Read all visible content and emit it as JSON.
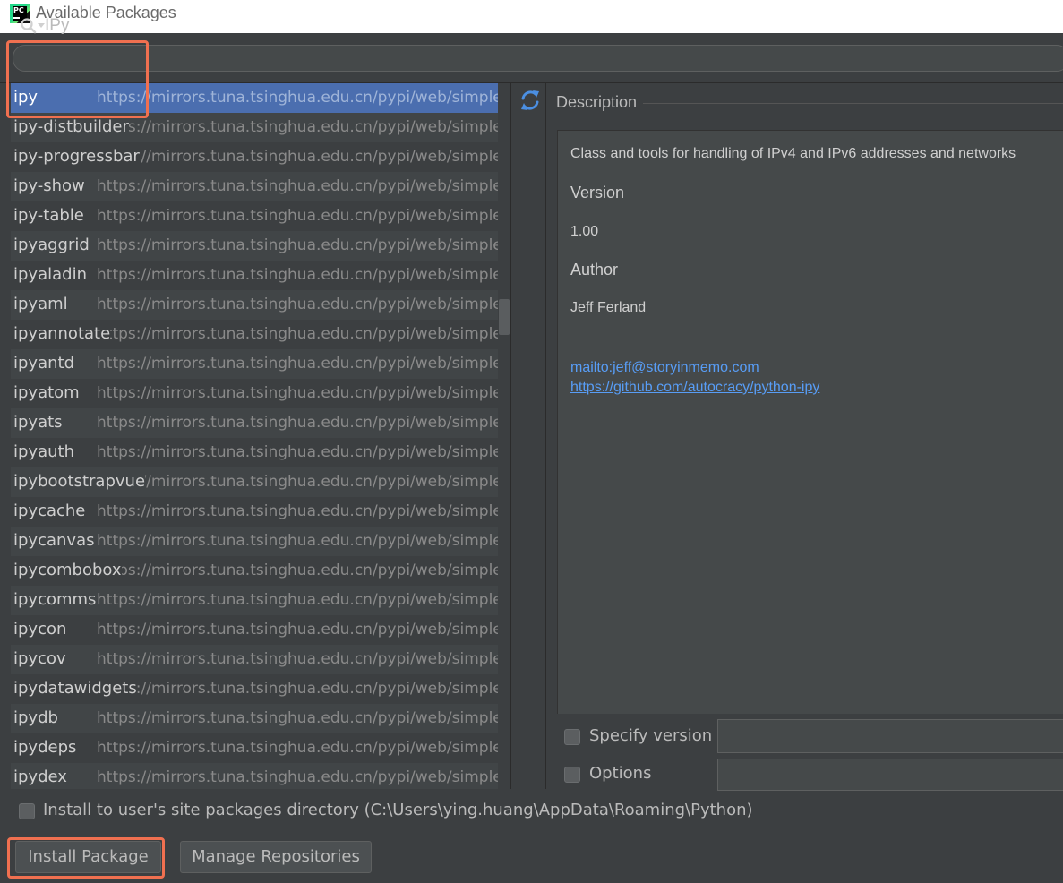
{
  "window": {
    "title": "Available Packages",
    "app_icon": "pycharm-icon",
    "app_icon_text": "PC"
  },
  "search": {
    "value": "IPy",
    "icon": "search-icon"
  },
  "packages": [
    {
      "name": "ipy",
      "repo": "https://mirrors.tuna.tsinghua.edu.cn/pypi/web/simple/"
    },
    {
      "name": "ipy-distbuilder",
      "repo": "https://mirrors.tuna.tsinghua.edu.cn/pypi/web/simple/"
    },
    {
      "name": "ipy-progressbar",
      "repo": "https://mirrors.tuna.tsinghua.edu.cn/pypi/web/simple/"
    },
    {
      "name": "ipy-show",
      "repo": "https://mirrors.tuna.tsinghua.edu.cn/pypi/web/simple/"
    },
    {
      "name": "ipy-table",
      "repo": "https://mirrors.tuna.tsinghua.edu.cn/pypi/web/simple/"
    },
    {
      "name": "ipyaggrid",
      "repo": "https://mirrors.tuna.tsinghua.edu.cn/pypi/web/simple/"
    },
    {
      "name": "ipyaladin",
      "repo": "https://mirrors.tuna.tsinghua.edu.cn/pypi/web/simple/"
    },
    {
      "name": "ipyaml",
      "repo": "https://mirrors.tuna.tsinghua.edu.cn/pypi/web/simple/"
    },
    {
      "name": "ipyannotate",
      "repo": "https://mirrors.tuna.tsinghua.edu.cn/pypi/web/simple/"
    },
    {
      "name": "ipyantd",
      "repo": "https://mirrors.tuna.tsinghua.edu.cn/pypi/web/simple/"
    },
    {
      "name": "ipyatom",
      "repo": "https://mirrors.tuna.tsinghua.edu.cn/pypi/web/simple/"
    },
    {
      "name": "ipyats",
      "repo": "https://mirrors.tuna.tsinghua.edu.cn/pypi/web/simple/"
    },
    {
      "name": "ipyauth",
      "repo": "https://mirrors.tuna.tsinghua.edu.cn/pypi/web/simple/"
    },
    {
      "name": "ipybootstrapvue",
      "repo": "https://mirrors.tuna.tsinghua.edu.cn/pypi/web/simple/"
    },
    {
      "name": "ipycache",
      "repo": "https://mirrors.tuna.tsinghua.edu.cn/pypi/web/simple/"
    },
    {
      "name": "ipycanvas",
      "repo": "https://mirrors.tuna.tsinghua.edu.cn/pypi/web/simple/"
    },
    {
      "name": "ipycombobox",
      "repo": "https://mirrors.tuna.tsinghua.edu.cn/pypi/web/simple/"
    },
    {
      "name": "ipycomms",
      "repo": "https://mirrors.tuna.tsinghua.edu.cn/pypi/web/simple/"
    },
    {
      "name": "ipycon",
      "repo": "https://mirrors.tuna.tsinghua.edu.cn/pypi/web/simple/"
    },
    {
      "name": "ipycov",
      "repo": "https://mirrors.tuna.tsinghua.edu.cn/pypi/web/simple/"
    },
    {
      "name": "ipydatawidgets",
      "repo": "https://mirrors.tuna.tsinghua.edu.cn/pypi/web/simple/"
    },
    {
      "name": "ipydb",
      "repo": "https://mirrors.tuna.tsinghua.edu.cn/pypi/web/simple/"
    },
    {
      "name": "ipydeps",
      "repo": "https://mirrors.tuna.tsinghua.edu.cn/pypi/web/simple/"
    },
    {
      "name": "ipydex",
      "repo": "https://mirrors.tuna.tsinghua.edu.cn/pypi/web/simple/"
    }
  ],
  "selected_package": "ipy",
  "refresh_icon": "refresh-icon",
  "description": {
    "label": "Description",
    "summary": "Class and tools for handling of IPv4 and IPv6 addresses and networks",
    "version_heading": "Version",
    "version": "1.00",
    "author_heading": "Author",
    "author": "Jeff Ferland",
    "links": [
      "mailto:jeff@storyinmemo.com",
      "https://github.com/autocracy/python-ipy"
    ]
  },
  "options": {
    "specify_version_label": "Specify version",
    "specify_version_checked": false,
    "options_label": "Options",
    "options_checked": false,
    "install_to_user_label": "Install to user's site packages directory (C:\\Users\\ying.huang\\AppData\\Roaming\\Python)",
    "install_to_user_checked": false
  },
  "buttons": {
    "install": "Install Package",
    "manage_repos": "Manage Repositories"
  },
  "colors": {
    "highlight": "#f07050",
    "selection": "#4b6eaf",
    "link": "#589df6",
    "background": "#3c3f41"
  }
}
